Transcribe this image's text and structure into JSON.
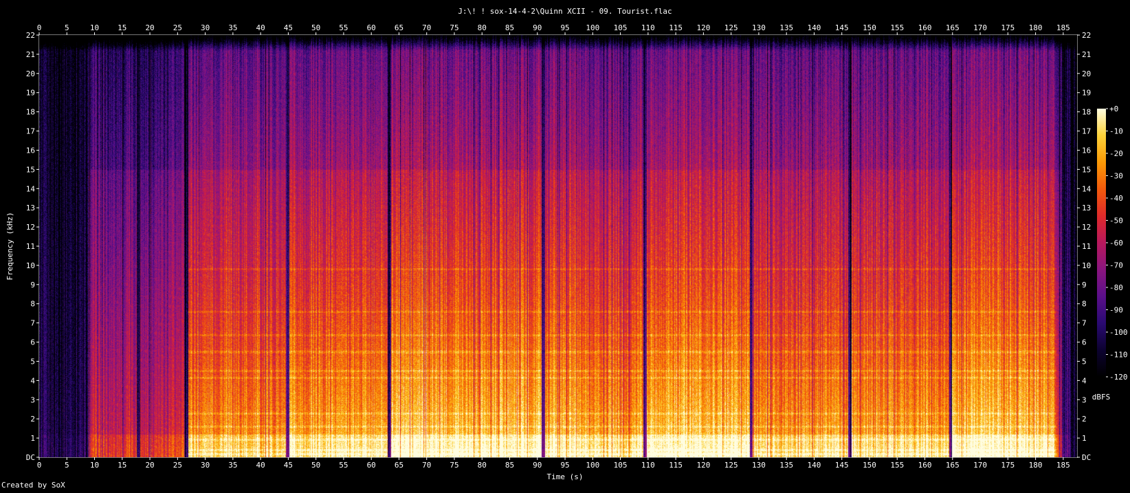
{
  "window": {
    "title": "J:\\! ! sox-14-4-2\\Quinn XCII - 09. Tourist.flac"
  },
  "footer": {
    "credit": "Created by SoX"
  },
  "chart_data": {
    "type": "heatmap",
    "title": "J:\\! ! sox-14-4-2\\Quinn XCII - 09. Tourist.flac",
    "xlabel": "Time (s)",
    "ylabel": "Frequency (kHz)",
    "x_ticks": [
      0,
      5,
      10,
      15,
      20,
      25,
      30,
      35,
      40,
      45,
      50,
      55,
      60,
      65,
      70,
      75,
      80,
      85,
      90,
      95,
      100,
      105,
      110,
      115,
      120,
      125,
      130,
      135,
      140,
      145,
      150,
      155,
      160,
      165,
      170,
      175,
      180,
      185
    ],
    "y_ticks": [
      "DC",
      "1",
      "2",
      "3",
      "4",
      "5",
      "6",
      "7",
      "8",
      "9",
      "10",
      "11",
      "12",
      "13",
      "14",
      "15",
      "16",
      "17",
      "18",
      "19",
      "20",
      "21",
      "22"
    ],
    "xlim": [
      0,
      187.5
    ],
    "ylim": [
      0,
      22
    ],
    "colorbar": {
      "label": "dBFS",
      "ticks": [
        "+0",
        "-10",
        "-20",
        "-30",
        "-40",
        "-50",
        "-60",
        "-70",
        "-80",
        "-90",
        "-100",
        "-110",
        "-120"
      ],
      "range": [
        -120,
        0
      ]
    },
    "colormap": [
      "#000000",
      "#0c0230",
      "#2a0a72",
      "#5b0f8a",
      "#8a157e",
      "#b8185c",
      "#de2a2a",
      "#f25a0c",
      "#fb9a06",
      "#fcd23a",
      "#fffde0"
    ],
    "energy_profile": [
      {
        "t": 0,
        "level": 0.15
      },
      {
        "t": 8.5,
        "level": 0.16
      },
      {
        "t": 9,
        "level": 0.55
      },
      {
        "t": 26.5,
        "level": 0.58
      },
      {
        "t": 27,
        "level": 0.82
      },
      {
        "t": 44.5,
        "level": 0.8
      },
      {
        "t": 45.5,
        "level": 0.85
      },
      {
        "t": 63,
        "level": 0.86
      },
      {
        "t": 64,
        "level": 0.93
      },
      {
        "t": 91,
        "level": 0.92
      },
      {
        "t": 91.5,
        "level": 0.88
      },
      {
        "t": 109,
        "level": 0.87
      },
      {
        "t": 110,
        "level": 0.93
      },
      {
        "t": 128,
        "level": 0.92
      },
      {
        "t": 129,
        "level": 0.82
      },
      {
        "t": 146.5,
        "level": 0.84
      },
      {
        "t": 147,
        "level": 0.84
      },
      {
        "t": 164.5,
        "level": 0.84
      },
      {
        "t": 165,
        "level": 0.93
      },
      {
        "t": 183,
        "level": 0.9
      },
      {
        "t": 185,
        "level": 0.35
      },
      {
        "t": 187.5,
        "level": 0.05
      }
    ],
    "dropouts_s": [
      8.6,
      17.9,
      26.6,
      44.8,
      63.2,
      91.0,
      109.4,
      128.6,
      146.4,
      164.6
    ]
  }
}
